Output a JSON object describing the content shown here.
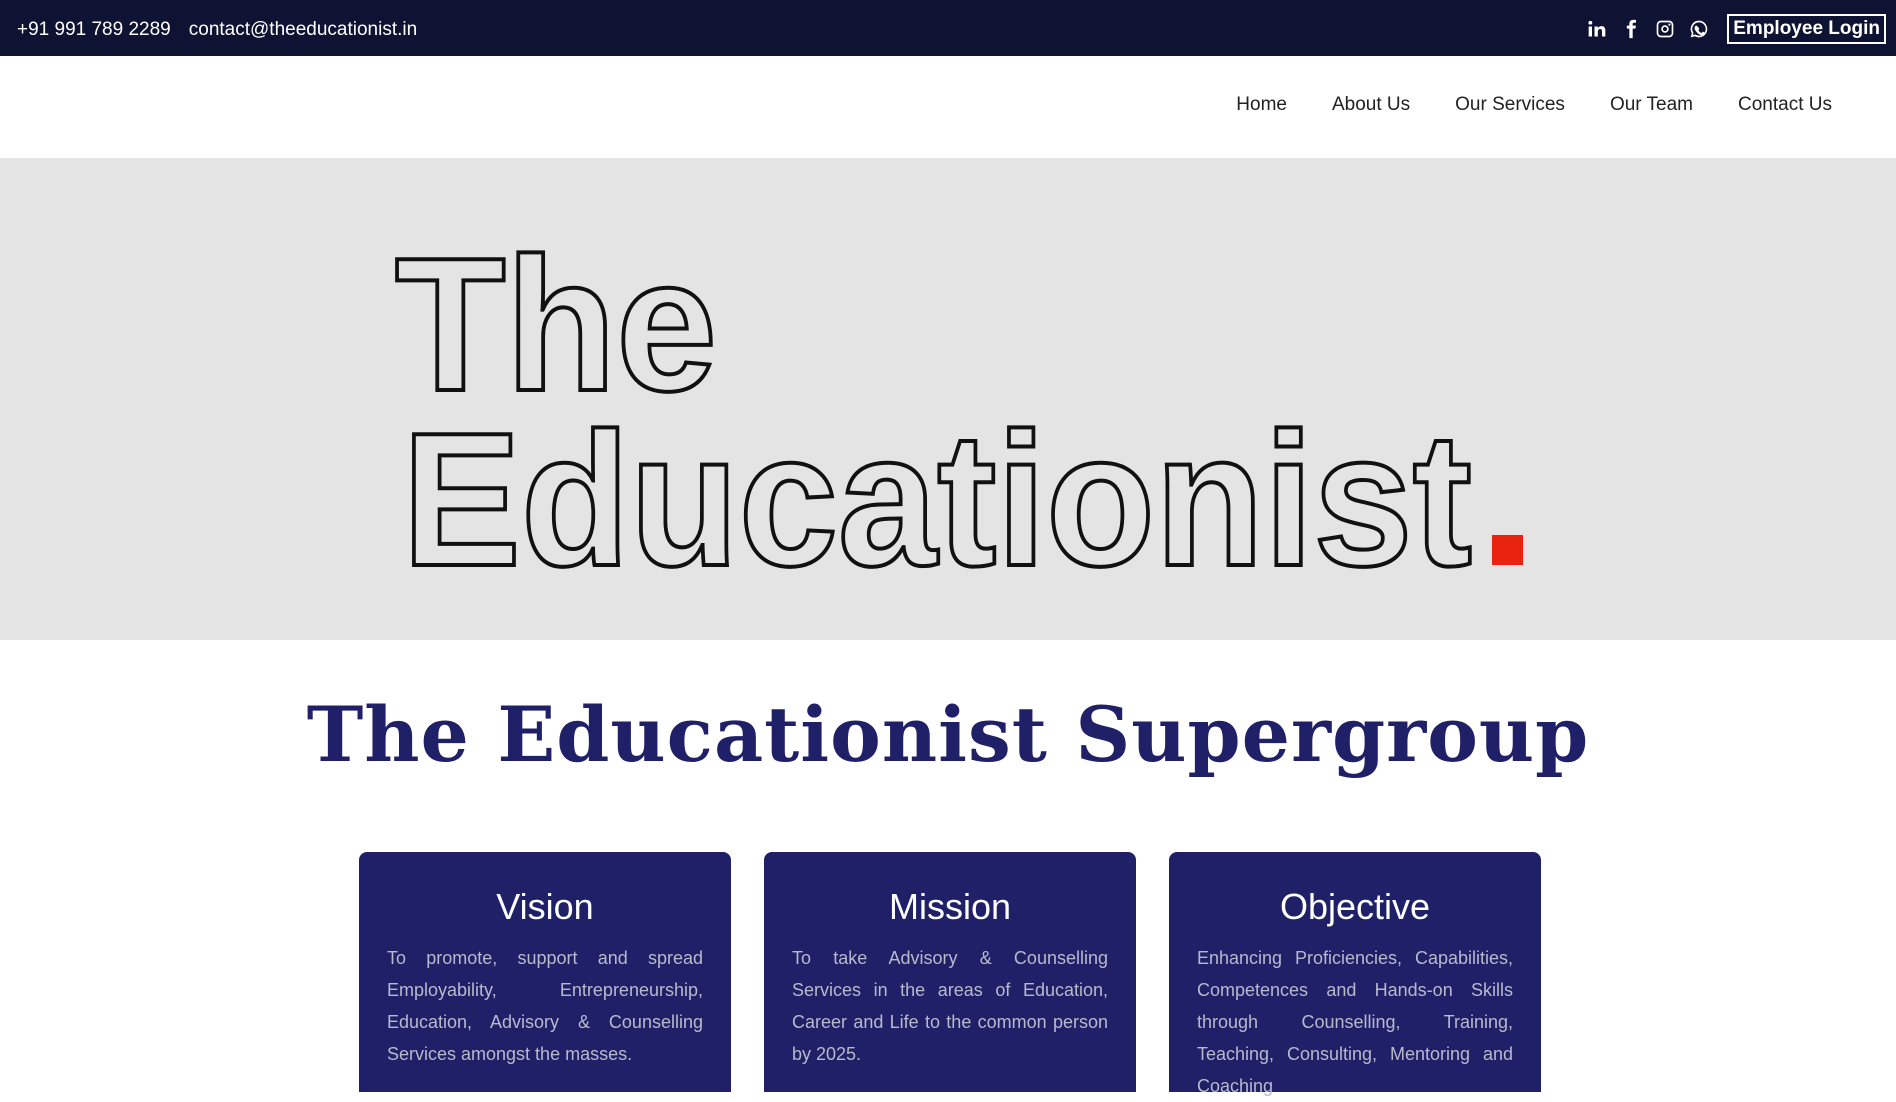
{
  "topbar": {
    "phone": "+91 991 789 2289",
    "email": "contact@theeducationist.in",
    "social_icons": [
      "linkedin-icon",
      "facebook-icon",
      "instagram-icon",
      "whatsapp-icon"
    ],
    "login_label": "Employee Login"
  },
  "nav": {
    "items": [
      "Home",
      "About Us",
      "Our Services",
      "Our Team",
      "Contact Us"
    ]
  },
  "hero": {
    "line1": "The",
    "line2": "Educationist",
    "dot": ".",
    "dot_color": "#e8230f"
  },
  "main": {
    "title": "The Educationist Supergroup",
    "cards": [
      {
        "title": "Vision",
        "text": "To promote, support and spread Employability, Entrepreneurship, Education, Advisory & Counselling Services amongst the masses."
      },
      {
        "title": "Mission",
        "text": "To take Advisory & Counselling Services in the areas of Education, Career and Life to the common person by 2025."
      },
      {
        "title": "Objective",
        "text": "Enhancing Proficiencies, Capabilities, Competences and Hands-on Skills through Counselling, Training, Teaching, Consulting, Mentoring and Coaching"
      }
    ]
  },
  "colors": {
    "topbar_bg": "#0e1233",
    "brand_navy": "#1f2068",
    "hero_bg": "#e4e4e4",
    "accent_red": "#e8230f"
  }
}
